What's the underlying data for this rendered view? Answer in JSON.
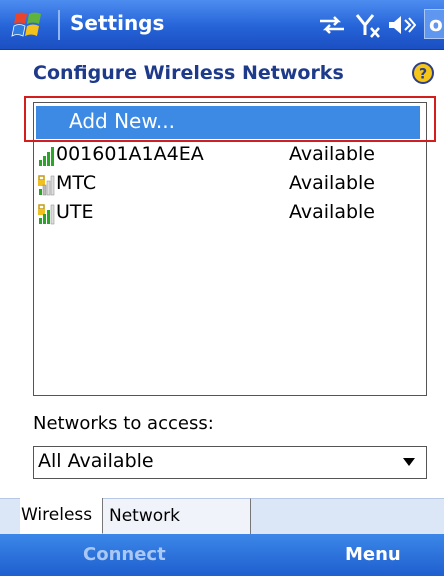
{
  "titlebar": {
    "title": "Settings",
    "ok_label": "ok",
    "icons": [
      "windows-start-icon",
      "sync-icon",
      "signal-off-icon",
      "volume-icon"
    ]
  },
  "header": {
    "title": "Configure Wireless Networks",
    "help_icon": "help-icon"
  },
  "network_list": {
    "add_new_label": "Add New...",
    "networks": [
      {
        "name": "001601A1A4EA",
        "status": "Available",
        "icon": "signal-strength-icon",
        "secured": false
      },
      {
        "name": "MTC",
        "status": "Available",
        "icon": "signal-locked-weak-icon",
        "secured": true
      },
      {
        "name": "UTE",
        "status": "Available",
        "icon": "signal-locked-icon",
        "secured": true
      }
    ]
  },
  "access": {
    "label": "Networks to access:",
    "selected": "All Available"
  },
  "tabs": [
    {
      "label": "Wireless",
      "active": true
    },
    {
      "label": "Network Adapters",
      "active": false
    }
  ],
  "softkeys": {
    "left": "Connect",
    "left_enabled": false,
    "right": "Menu"
  },
  "colors": {
    "titlebar": "#2563d7",
    "selection": "#3c8ae4",
    "highlight_frame": "#d41e1e",
    "softkeys": "#1f5fcf"
  }
}
